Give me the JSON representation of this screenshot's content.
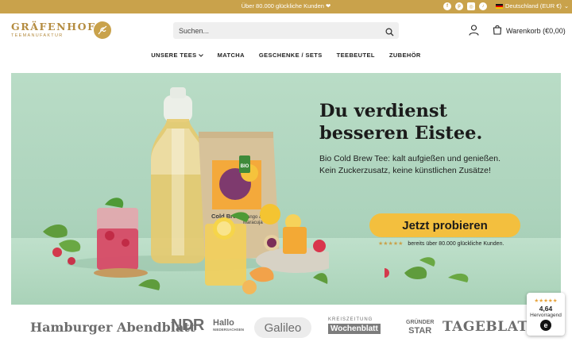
{
  "announcement": {
    "text": "Über 80.000 glückliche Kunden ❤",
    "socials": [
      {
        "icon": "facebook-icon",
        "glyph": "f"
      },
      {
        "icon": "pinterest-icon",
        "glyph": "p"
      },
      {
        "icon": "instagram-icon",
        "glyph": "◎"
      },
      {
        "icon": "tiktok-icon",
        "glyph": "♪"
      }
    ],
    "country": "Deutschland (EUR €)"
  },
  "header": {
    "logo_name": "GRÄFENHOF",
    "logo_sub": "TEEMANUFAKTUR",
    "search_placeholder": "Suchen...",
    "cart_label": "Warenkorb (€0,00)",
    "icons": {
      "search": "search-icon",
      "account": "user-icon",
      "cart": "shopping-bag-icon"
    }
  },
  "nav": {
    "items": [
      "UNSERE TEES",
      "MATCHA",
      "GESCHENKE / SETS",
      "TEEBEUTEL",
      "ZUBEHÖR"
    ]
  },
  "hero": {
    "headline_line1": "Du verdienst",
    "headline_line2": "besseren Eistee.",
    "sub_line1": "Bio Cold Brew Tee: kalt aufgießen und genießen.",
    "sub_line2": "Kein Zuckerzusatz, keine künstlichen Zusätze!",
    "cta": "Jetzt probieren",
    "stars": "★★★★★",
    "social_proof": "bereits über 80.000 glückliche Kunden.",
    "product_label_1": "Cold Brew",
    "product_label_2": "Mango &",
    "product_label_3": "Maracuja",
    "product_badge": "BIO",
    "colors": {
      "cta": "#f3bf3e",
      "accent": "#c9a24b",
      "background": "#b9dcc6"
    }
  },
  "press": {
    "logos": [
      "Hamburger Abendblatt",
      "NDR",
      "Hallo",
      "NIEDERSACHSEN",
      "Galileo",
      "KREISZEITUNG",
      "Wochenblatt",
      "GRÜNDER",
      "STAR",
      "TAGEBLATT"
    ]
  },
  "trust_badge": {
    "stars": "★★★★★",
    "score": "4,64",
    "label": "Hervorragend",
    "mark": "e"
  }
}
